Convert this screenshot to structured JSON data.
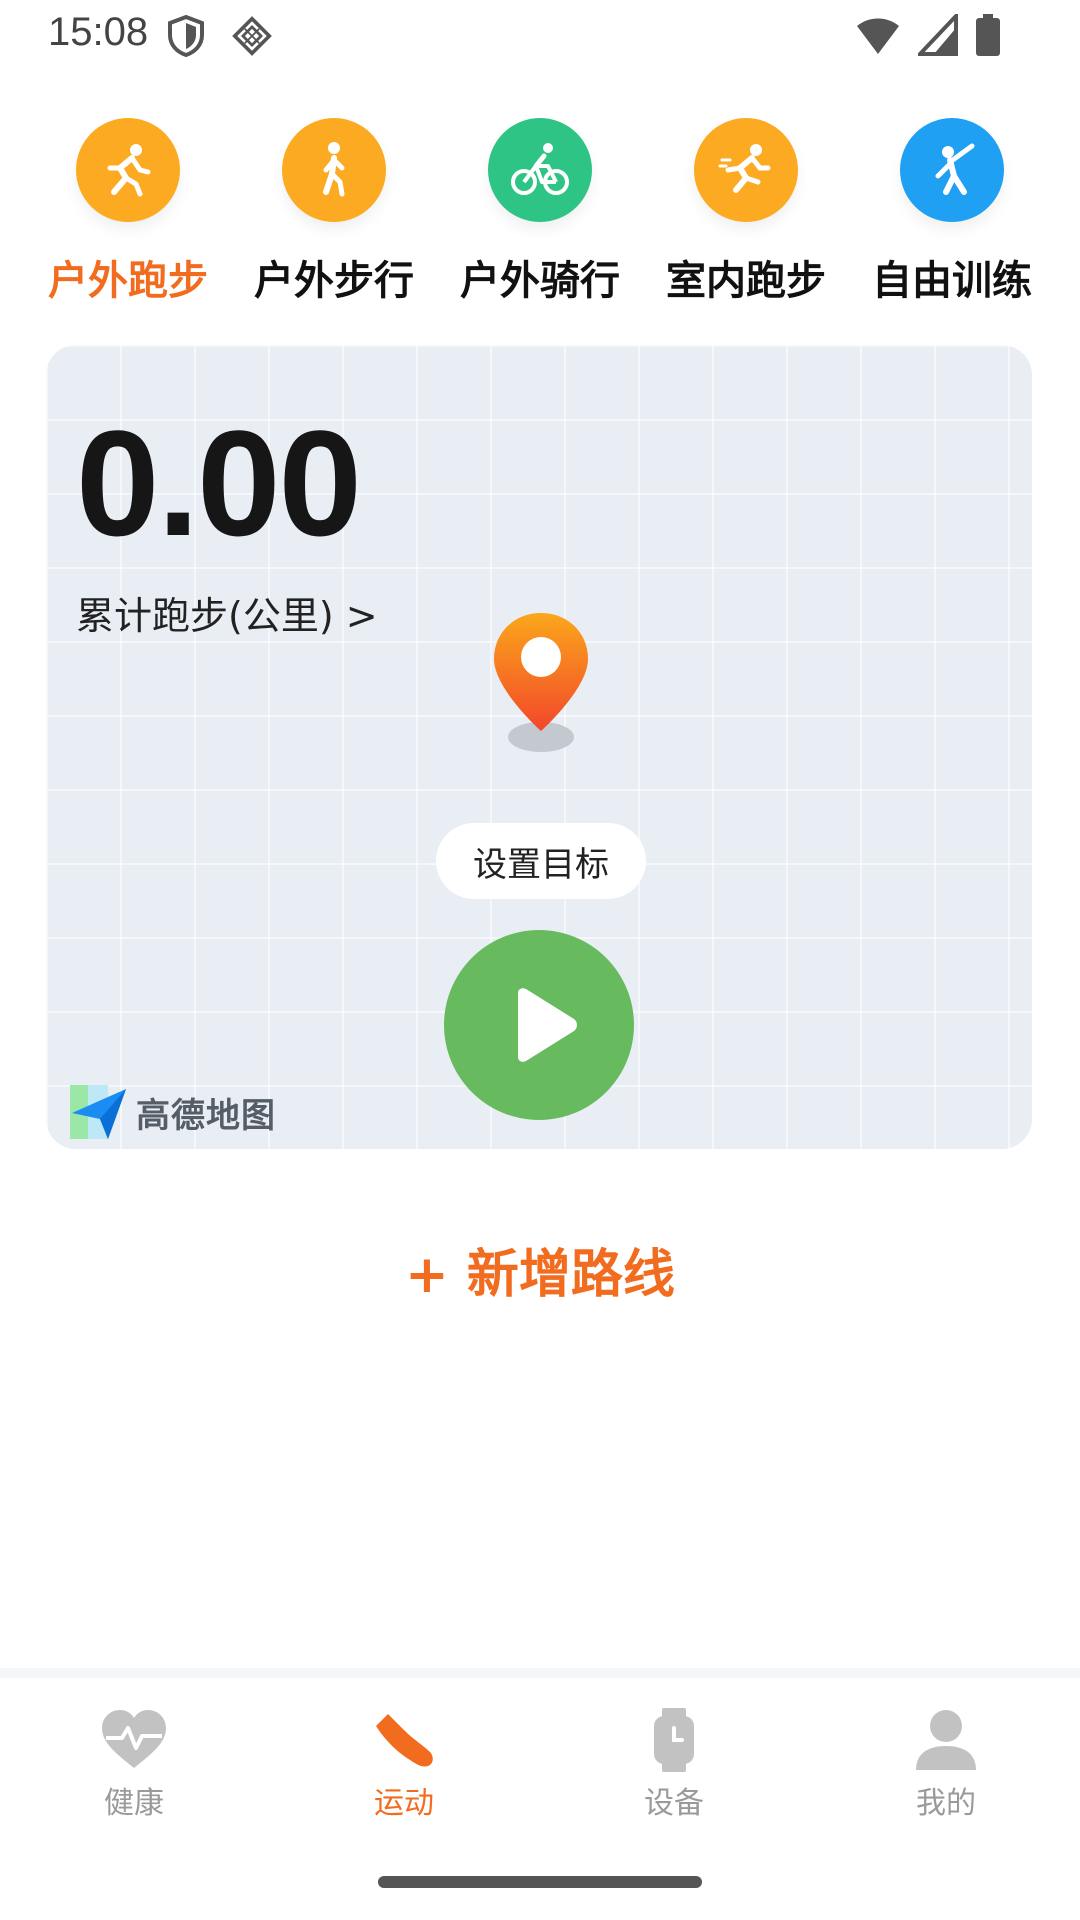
{
  "status_bar": {
    "time": "15:08",
    "icons": [
      "shield-icon",
      "vpn-diamond-icon",
      "wifi-icon",
      "signal-icon",
      "battery-icon"
    ]
  },
  "modes": [
    {
      "label": "户外跑步",
      "icon": "running-icon",
      "color": "#fbaa22",
      "active": true
    },
    {
      "label": "户外步行",
      "icon": "walking-icon",
      "color": "#fbaa22",
      "active": false
    },
    {
      "label": "户外骑行",
      "icon": "cycling-icon",
      "color": "#2ec486",
      "active": false
    },
    {
      "label": "室内跑步",
      "icon": "treadmill-run-icon",
      "color": "#fbaa22",
      "active": false
    },
    {
      "label": "自由训练",
      "icon": "free-training-icon",
      "color": "#1fa0f3",
      "active": false
    }
  ],
  "card": {
    "distance_value": "0.00",
    "distance_label": "累计跑步(公里) >",
    "goal_button": "设置目标",
    "map_provider": "高德地图"
  },
  "add_route": "+ 新增路线",
  "nav": [
    {
      "label": "健康",
      "icon": "heart-pulse-icon",
      "active": false
    },
    {
      "label": "运动",
      "icon": "sneaker-icon",
      "active": true
    },
    {
      "label": "设备",
      "icon": "watch-icon",
      "active": false
    },
    {
      "label": "我的",
      "icon": "person-icon",
      "active": false
    }
  ],
  "colors": {
    "accent": "#f26c1f",
    "start_green": "#67bb5e",
    "card_bg": "#e9eef5",
    "inactive_nav": "#9a9a9a"
  }
}
